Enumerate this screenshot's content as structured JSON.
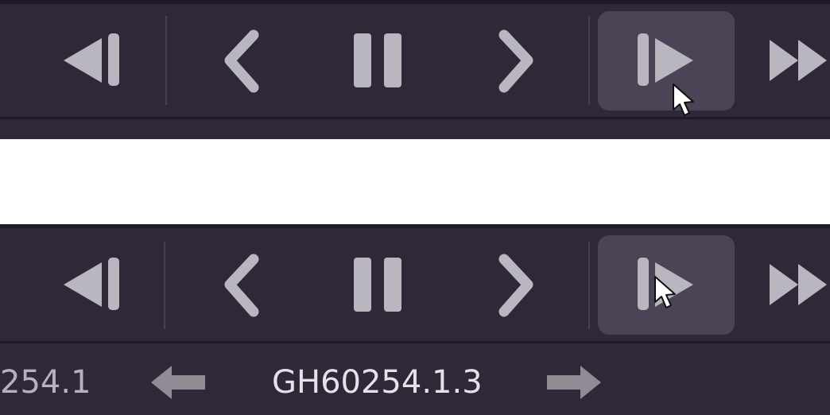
{
  "toolbar": {
    "buttons": [
      {
        "name": "step-back",
        "icon": "step-back-icon"
      },
      {
        "name": "previous",
        "icon": "chevron-left-icon"
      },
      {
        "name": "pause",
        "icon": "pause-icon"
      },
      {
        "name": "next",
        "icon": "chevron-right-icon"
      },
      {
        "name": "step-forward",
        "icon": "step-forward-icon",
        "state": "hover"
      },
      {
        "name": "fast-forward",
        "icon": "fast-forward-icon"
      }
    ]
  },
  "nav": {
    "previous_label": "254.1",
    "current_label": "GH60254.1.3"
  },
  "colors": {
    "panel_bg": "#2e2838",
    "icon": "#b9b6bf",
    "hover_bg": "#4a4456",
    "text": "#e4e1e8",
    "arrow": "#8f8c95"
  }
}
